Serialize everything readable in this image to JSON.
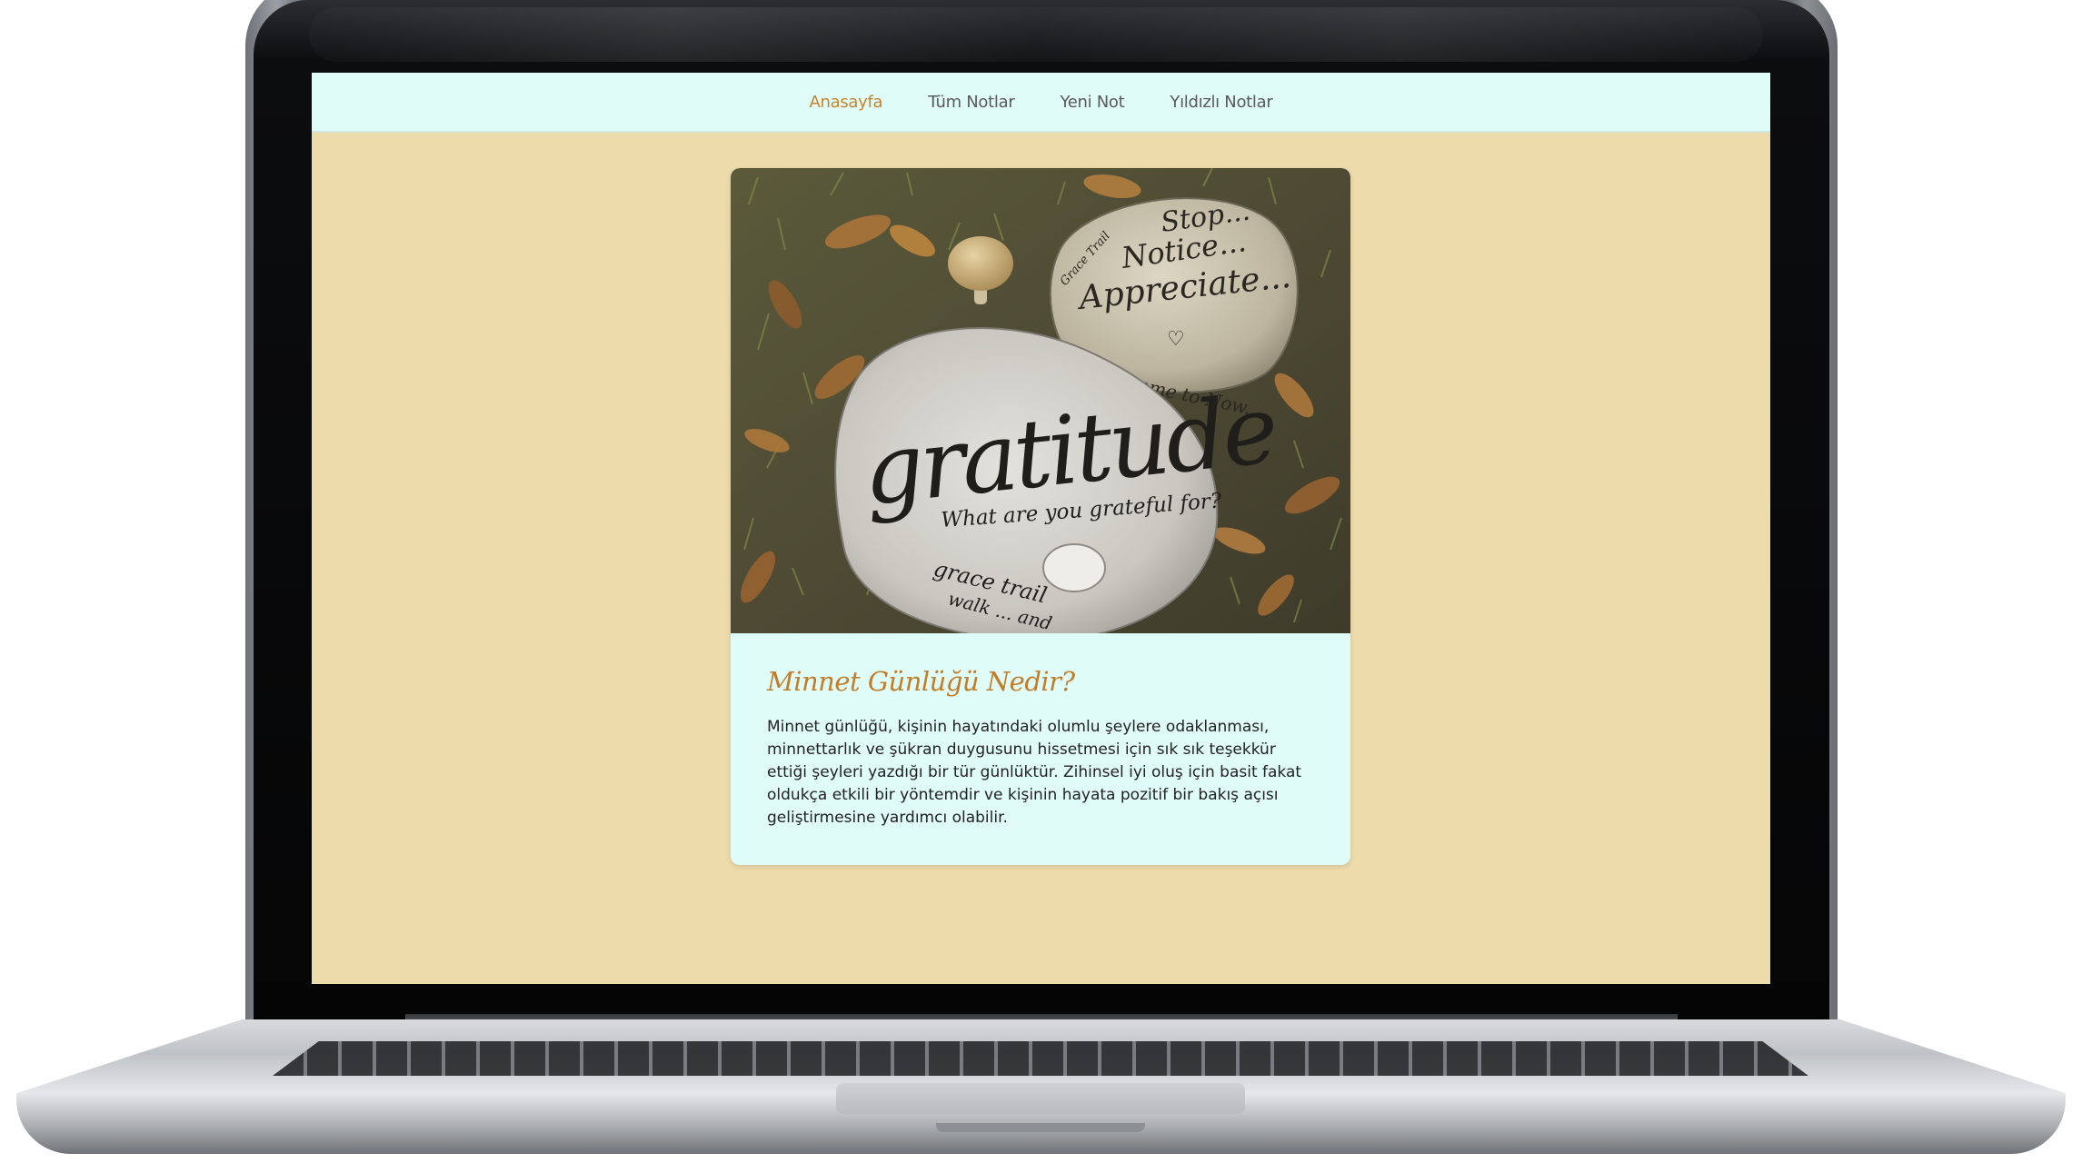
{
  "nav": {
    "items": [
      {
        "label": "Anasayfa",
        "active": true
      },
      {
        "label": "Tüm Notlar",
        "active": false
      },
      {
        "label": "Yeni Not",
        "active": false
      },
      {
        "label": "Yıldızlı Notlar",
        "active": false
      }
    ]
  },
  "card": {
    "image": {
      "big_stone_word": "gratitude",
      "big_stone_question": "What are you grateful for?",
      "big_stone_bottom1": "grace trail",
      "big_stone_bottom2": "walk ... and",
      "small_stone_line1": "Stop...",
      "small_stone_line2": "Notice...",
      "small_stone_line3": "Appreciate...",
      "small_stone_line4": "Welcome to Now...",
      "small_stone_tag": "Grace Trail"
    },
    "title": "Minnet Günlüğü Nedir?",
    "body": "Minnet günlüğü, kişinin hayatındaki olumlu şeylere odaklanması, minnettarlık ve şükran duygusunu hissetmesi için sık sık teşekkür ettiği şeyleri yazdığı bir tür günlüktür. Zihinsel iyi oluş için basit fakat oldukça etkili bir yöntemdir ve kişinin hayata pozitif bir bakış açısı geliştirmesine yardımcı olabilir."
  },
  "colors": {
    "page_background": "#ecdbab",
    "navbar_background": "#e0fcf8",
    "accent": "#c7832c",
    "card_background": "#e0fcf8"
  }
}
